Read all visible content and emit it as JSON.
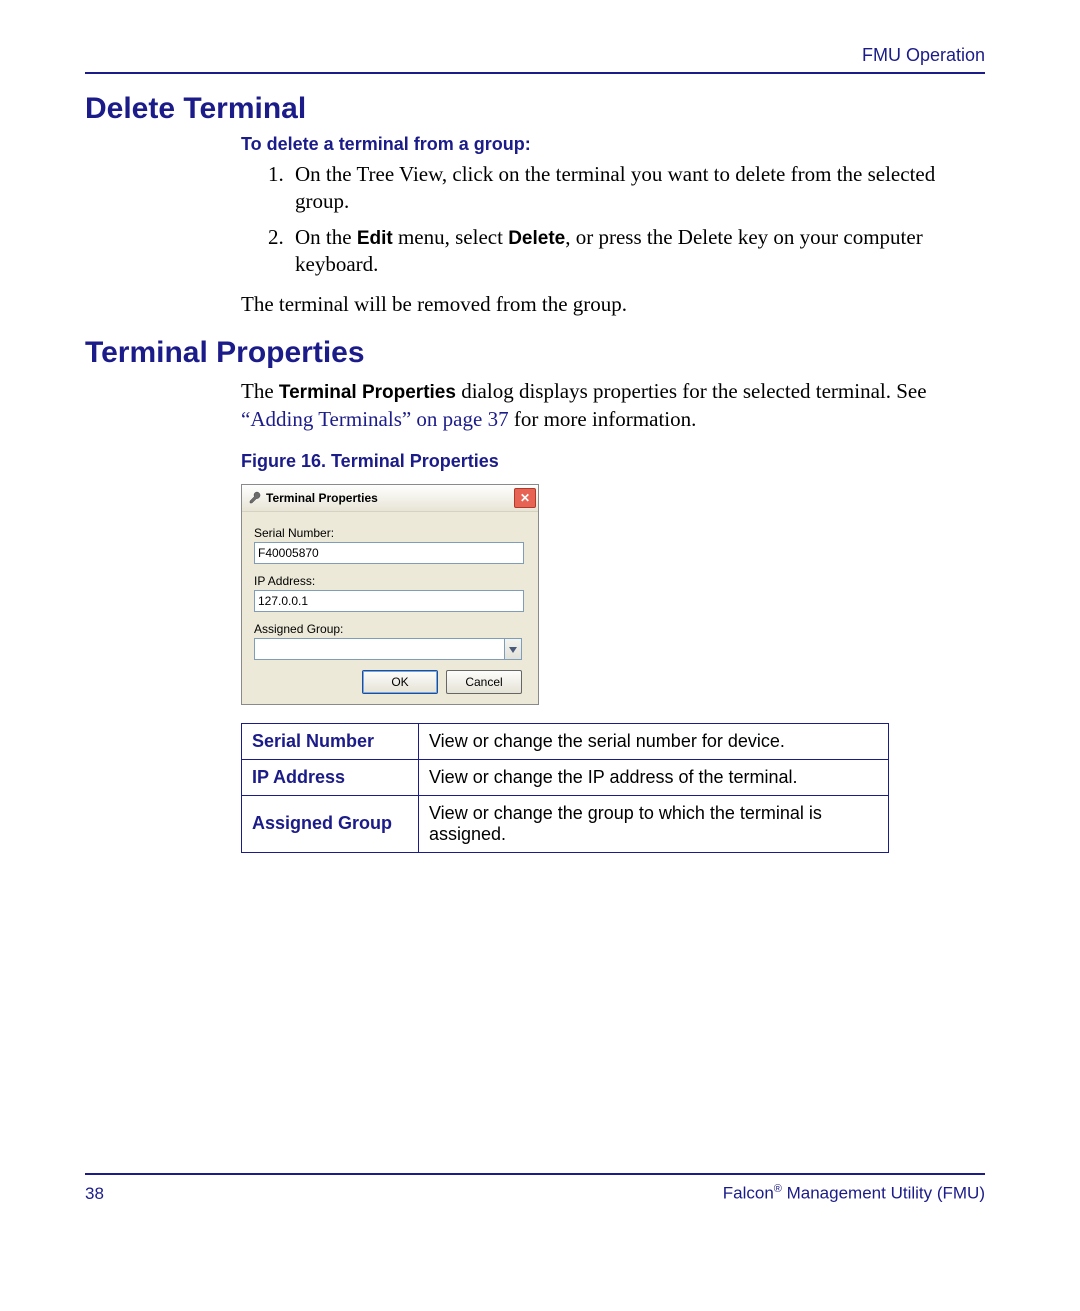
{
  "header": {
    "right": "FMU Operation"
  },
  "section1": {
    "heading": "Delete Terminal",
    "subheading": "To delete a terminal from a group:",
    "steps": {
      "s1": "On the Tree View, click on the terminal you want to delete from the selected group.",
      "s2_pre": "On the ",
      "s2_edit": "Edit",
      "s2_mid": " menu, select ",
      "s2_delete": "Delete",
      "s2_post": ", or press the Delete key on your computer keyboard."
    },
    "result": "The terminal will be removed from the group."
  },
  "section2": {
    "heading": "Terminal Properties",
    "para_pre": "The ",
    "para_bold": "Terminal Properties",
    "para_mid": " dialog displays properties for the selected terminal. See ",
    "xref": "“Adding Terminals” on page 37",
    "para_post": " for more information.",
    "fig_caption": "Figure 16. Terminal Properties"
  },
  "dialog": {
    "title": "Terminal Properties",
    "labels": {
      "serial": "Serial Number:",
      "ip": "IP Address:",
      "group": "Assigned Group:"
    },
    "values": {
      "serial": "F40005870",
      "ip": "127.0.0.1",
      "group": ""
    },
    "buttons": {
      "ok": "OK",
      "cancel": "Cancel"
    }
  },
  "prop_table": [
    {
      "key": "Serial Number",
      "desc": "View or change the serial number for device."
    },
    {
      "key": "IP Address",
      "desc": "View or change the IP address of the terminal."
    },
    {
      "key": "Assigned Group",
      "desc": "View or change the group to which the terminal is assigned."
    }
  ],
  "footer": {
    "page": "38",
    "product_pre": "Falcon",
    "reg": "®",
    "product_post": " Management Utility (FMU)"
  }
}
